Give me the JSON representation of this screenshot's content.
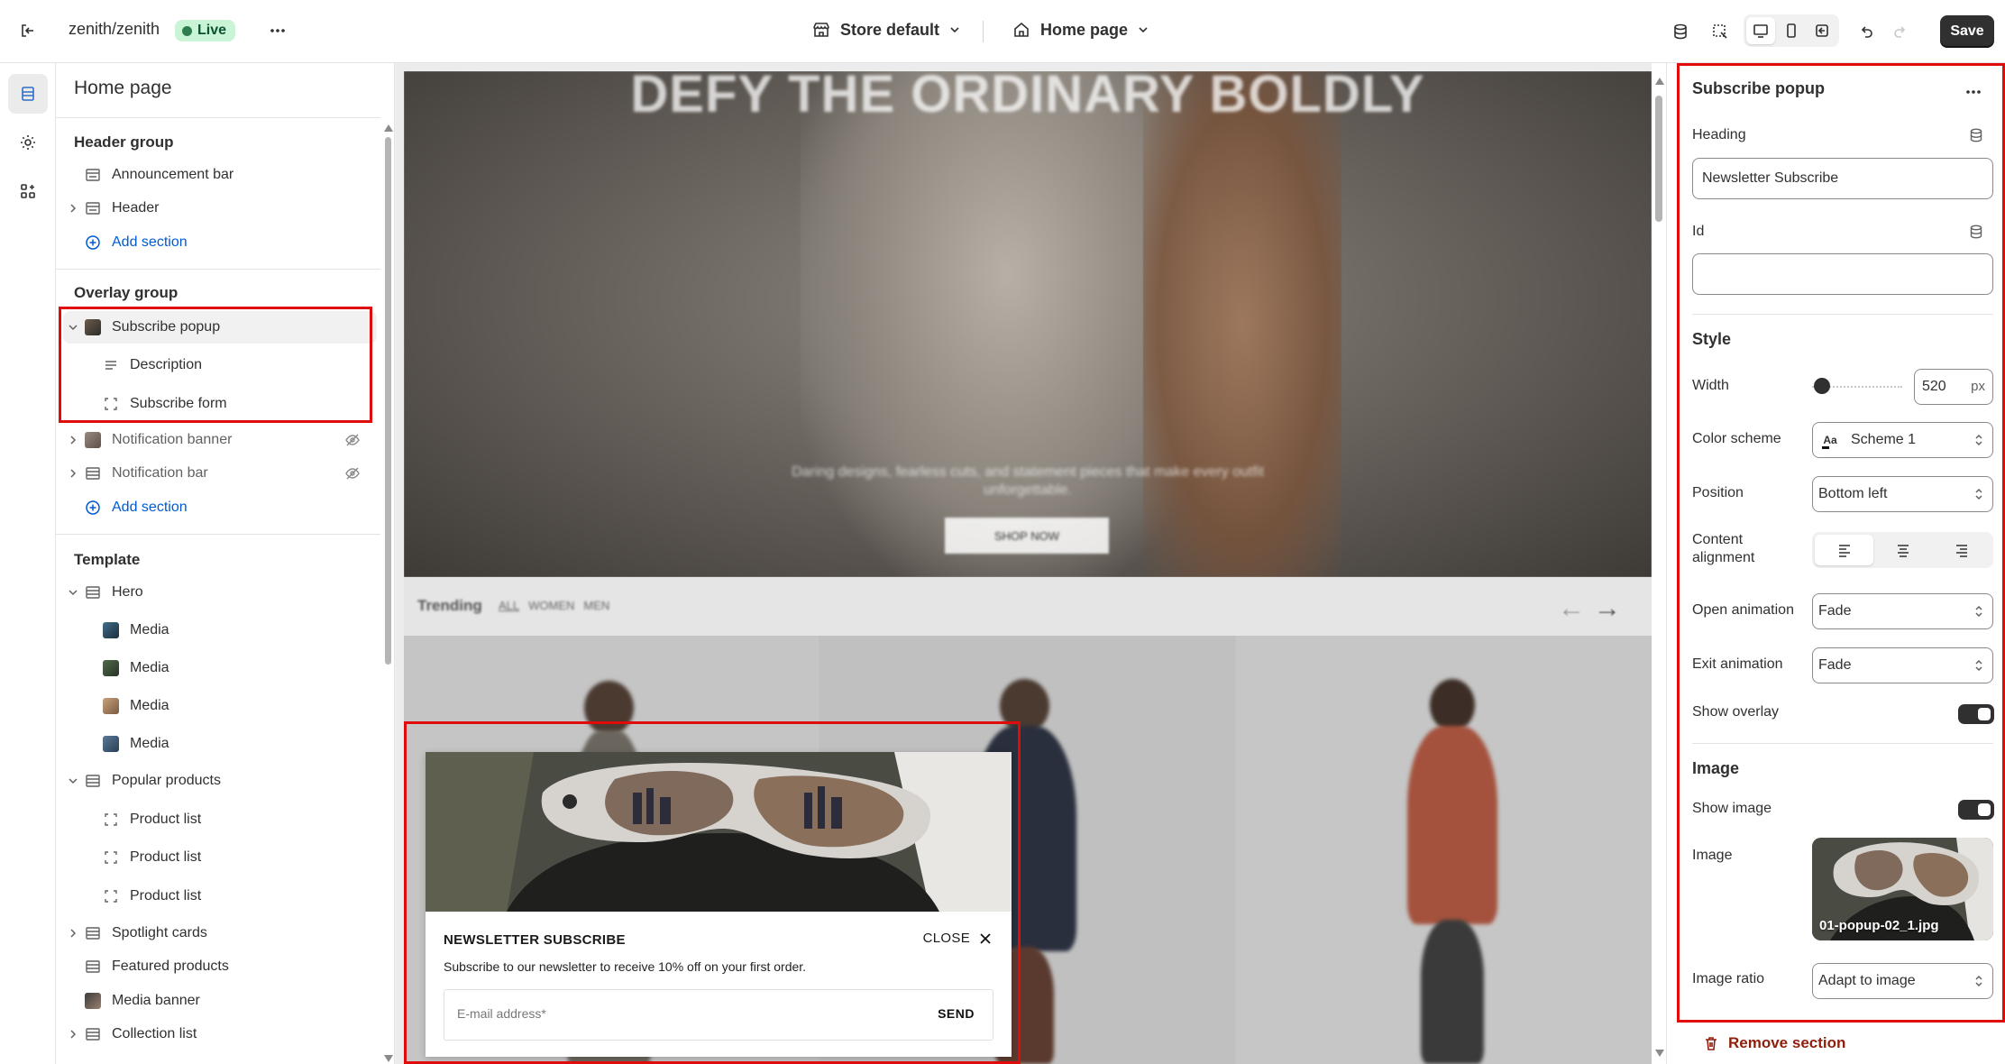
{
  "topbar": {
    "store_name": "zenith/zenith",
    "live_badge": "Live",
    "store_selector": "Store default",
    "page_selector": "Home page",
    "save_label": "Save"
  },
  "sidebar": {
    "title": "Home page",
    "header_group": {
      "title": "Header group",
      "items": [
        "Announcement bar",
        "Header"
      ],
      "add_label": "Add section"
    },
    "overlay_group": {
      "title": "Overlay group",
      "items": [
        "Subscribe popup",
        "Description",
        "Subscribe form",
        "Notification banner",
        "Notification bar"
      ],
      "add_label": "Add section"
    },
    "template": {
      "title": "Template",
      "items": [
        "Hero",
        "Media",
        "Media",
        "Media",
        "Media",
        "Popular products",
        "Product list",
        "Product list",
        "Product list",
        "Spotlight cards",
        "Featured products",
        "Media banner",
        "Collection list"
      ]
    }
  },
  "preview": {
    "hero_title": "DEFY THE ORDINARY BOLDLY",
    "hero_subtitle": "Daring designs, fearless cuts, and statement pieces that make every outfit unforgettable.",
    "hero_button": "SHOP NOW",
    "trending_label": "Trending",
    "trending_tabs": [
      "ALL",
      "WOMEN",
      "MEN"
    ],
    "popup": {
      "heading": "NEWSLETTER SUBSCRIBE",
      "close_label": "CLOSE",
      "description": "Subscribe to our newsletter to receive 10% off on your first order.",
      "email_placeholder": "E-mail address*",
      "send_label": "SEND"
    }
  },
  "panel": {
    "title": "Subscribe popup",
    "heading_label": "Heading",
    "heading_value": "Newsletter Subscribe",
    "id_label": "Id",
    "id_value": "",
    "style_title": "Style",
    "width_label": "Width",
    "width_value": "520",
    "width_unit": "px",
    "color_scheme_label": "Color scheme",
    "color_scheme_icon_text": "Aa",
    "color_scheme_value": "Scheme 1",
    "position_label": "Position",
    "position_value": "Bottom left",
    "content_alignment_label_1": "Content",
    "content_alignment_label_2": "alignment",
    "open_animation_label": "Open animation",
    "open_animation_value": "Fade",
    "exit_animation_label": "Exit animation",
    "exit_animation_value": "Fade",
    "show_overlay_label": "Show overlay",
    "image_title": "Image",
    "show_image_label": "Show image",
    "image_label": "Image",
    "image_filename": "01-popup-02_1.jpg",
    "image_ratio_label": "Image ratio",
    "image_ratio_value": "Adapt to image",
    "remove_label": "Remove section"
  },
  "colors": {
    "accent": "#005bd3",
    "highlight": "#e00b0b",
    "live_bg": "#c9f4d6",
    "danger": "#8e1f0b"
  }
}
